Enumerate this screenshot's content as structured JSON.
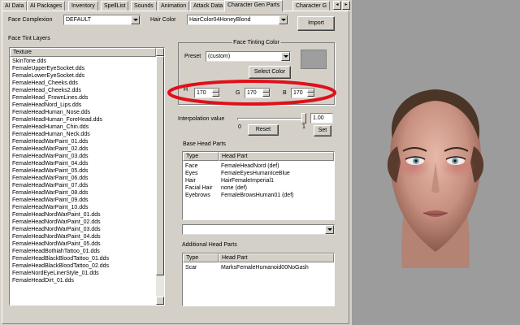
{
  "tabs": [
    {
      "label": "AI Data",
      "active": false
    },
    {
      "label": "AI Packages",
      "active": false
    },
    {
      "label": "Inventory",
      "active": false
    },
    {
      "label": "SpellList",
      "active": false
    },
    {
      "label": "Sounds",
      "active": false
    },
    {
      "label": "Animation",
      "active": false
    },
    {
      "label": "Attack Data",
      "active": false
    },
    {
      "label": "Character Gen Parts",
      "active": true
    },
    {
      "label": "Character G",
      "active": false
    }
  ],
  "tab_scroll": {
    "left": "◂",
    "right": "▸"
  },
  "face_complexion": {
    "label": "Face Complexion",
    "value": "DEFAULT"
  },
  "hair_color": {
    "label": "Hair Color",
    "value": "HairColor04HoneyBlond"
  },
  "import_button": "Import",
  "face_tint_layers": {
    "label": "Face Tint Layers",
    "column": "Texture",
    "items": [
      "SkinTone.dds",
      "FemaleUpperEyeSocket.dds",
      "FemaleLowerEyeSocket.dds",
      "FemaleHead_Cheeks.dds",
      "FemaleHead_Cheeks2.dds",
      "FemaleHead_FrownLines.dds",
      "FemaleHeadNord_Lips.dds",
      "FemaleHeadHuman_Nose.dds",
      "FemaleHeadHuman_ForeHead.dds",
      "FemaleHeadHuman_Chin.dds",
      "FemaleHeadHuman_Neck.dds",
      "FemaleHeadWarPaint_01.dds",
      "FemaleHeadWarPaint_02.dds",
      "FemaleHeadWarPaint_03.dds",
      "FemaleHeadWarPaint_04.dds",
      "FemaleHeadWarPaint_05.dds",
      "FemaleHeadWarPaint_06.dds",
      "FemaleHeadWarPaint_07.dds",
      "FemaleHeadWarPaint_08.dds",
      "FemaleHeadWarPaint_09.dds",
      "FemaleHeadWarPaint_10.dds",
      "FemaleHeadNordWarPaint_01.dds",
      "FemaleHeadNordWarPaint_02.dds",
      "FemaleHeadNordWarPaint_03.dds",
      "FemaleHeadNordWarPaint_04.dds",
      "FemaleHeadNordWarPaint_05.dds",
      "FemaleHeadBothiahTattoo_01.dds",
      "FemaleHeadBlackBloodTattoo_01.dds",
      "FemaleHeadBlackBloodTattoo_02.dds",
      "FemaleNordEyeLinerStyle_01.dds",
      "FemaleHeadDirt_01.dds"
    ]
  },
  "face_tinting_color": {
    "title": "Face Tinting Color",
    "preset_label": "Preset",
    "preset_value": "(custom)",
    "select_color_button": "Select Color",
    "swatch_color": "#9e9e9e",
    "h_label": "H",
    "h_value": "170",
    "g_label": "G",
    "g_value": "170",
    "b_label": "B",
    "b_value": "170",
    "highlight_color": "#e0101a"
  },
  "interpolation": {
    "label": "Interpolation value",
    "min": "0",
    "max": "1",
    "value": "1.00",
    "reset_button": "Reset",
    "set_button": "Set"
  },
  "base_head_parts": {
    "label": "Base Head Parts",
    "columns": [
      "Type",
      "Head Part"
    ],
    "rows": [
      {
        "type": "Face",
        "part": "FemaleHeadNord (def)"
      },
      {
        "type": "Eyes",
        "part": "FemaleEyesHumanIceBlue"
      },
      {
        "type": "Hair",
        "part": "HairFemaleImperial1"
      },
      {
        "type": "Facial Hair",
        "part": "none (def)"
      },
      {
        "type": "Eyebrows",
        "part": "FemaleBrowsHuman01 (def)"
      }
    ]
  },
  "head_part_select": "",
  "additional_head_parts": {
    "label": "Additional Head Parts",
    "columns": [
      "Type",
      "Head Part"
    ],
    "rows": [
      {
        "type": "Scar",
        "part": "MarksFemaleHumanoid00NoGash"
      }
    ]
  },
  "preview": {
    "background": "#9c9c9c"
  }
}
